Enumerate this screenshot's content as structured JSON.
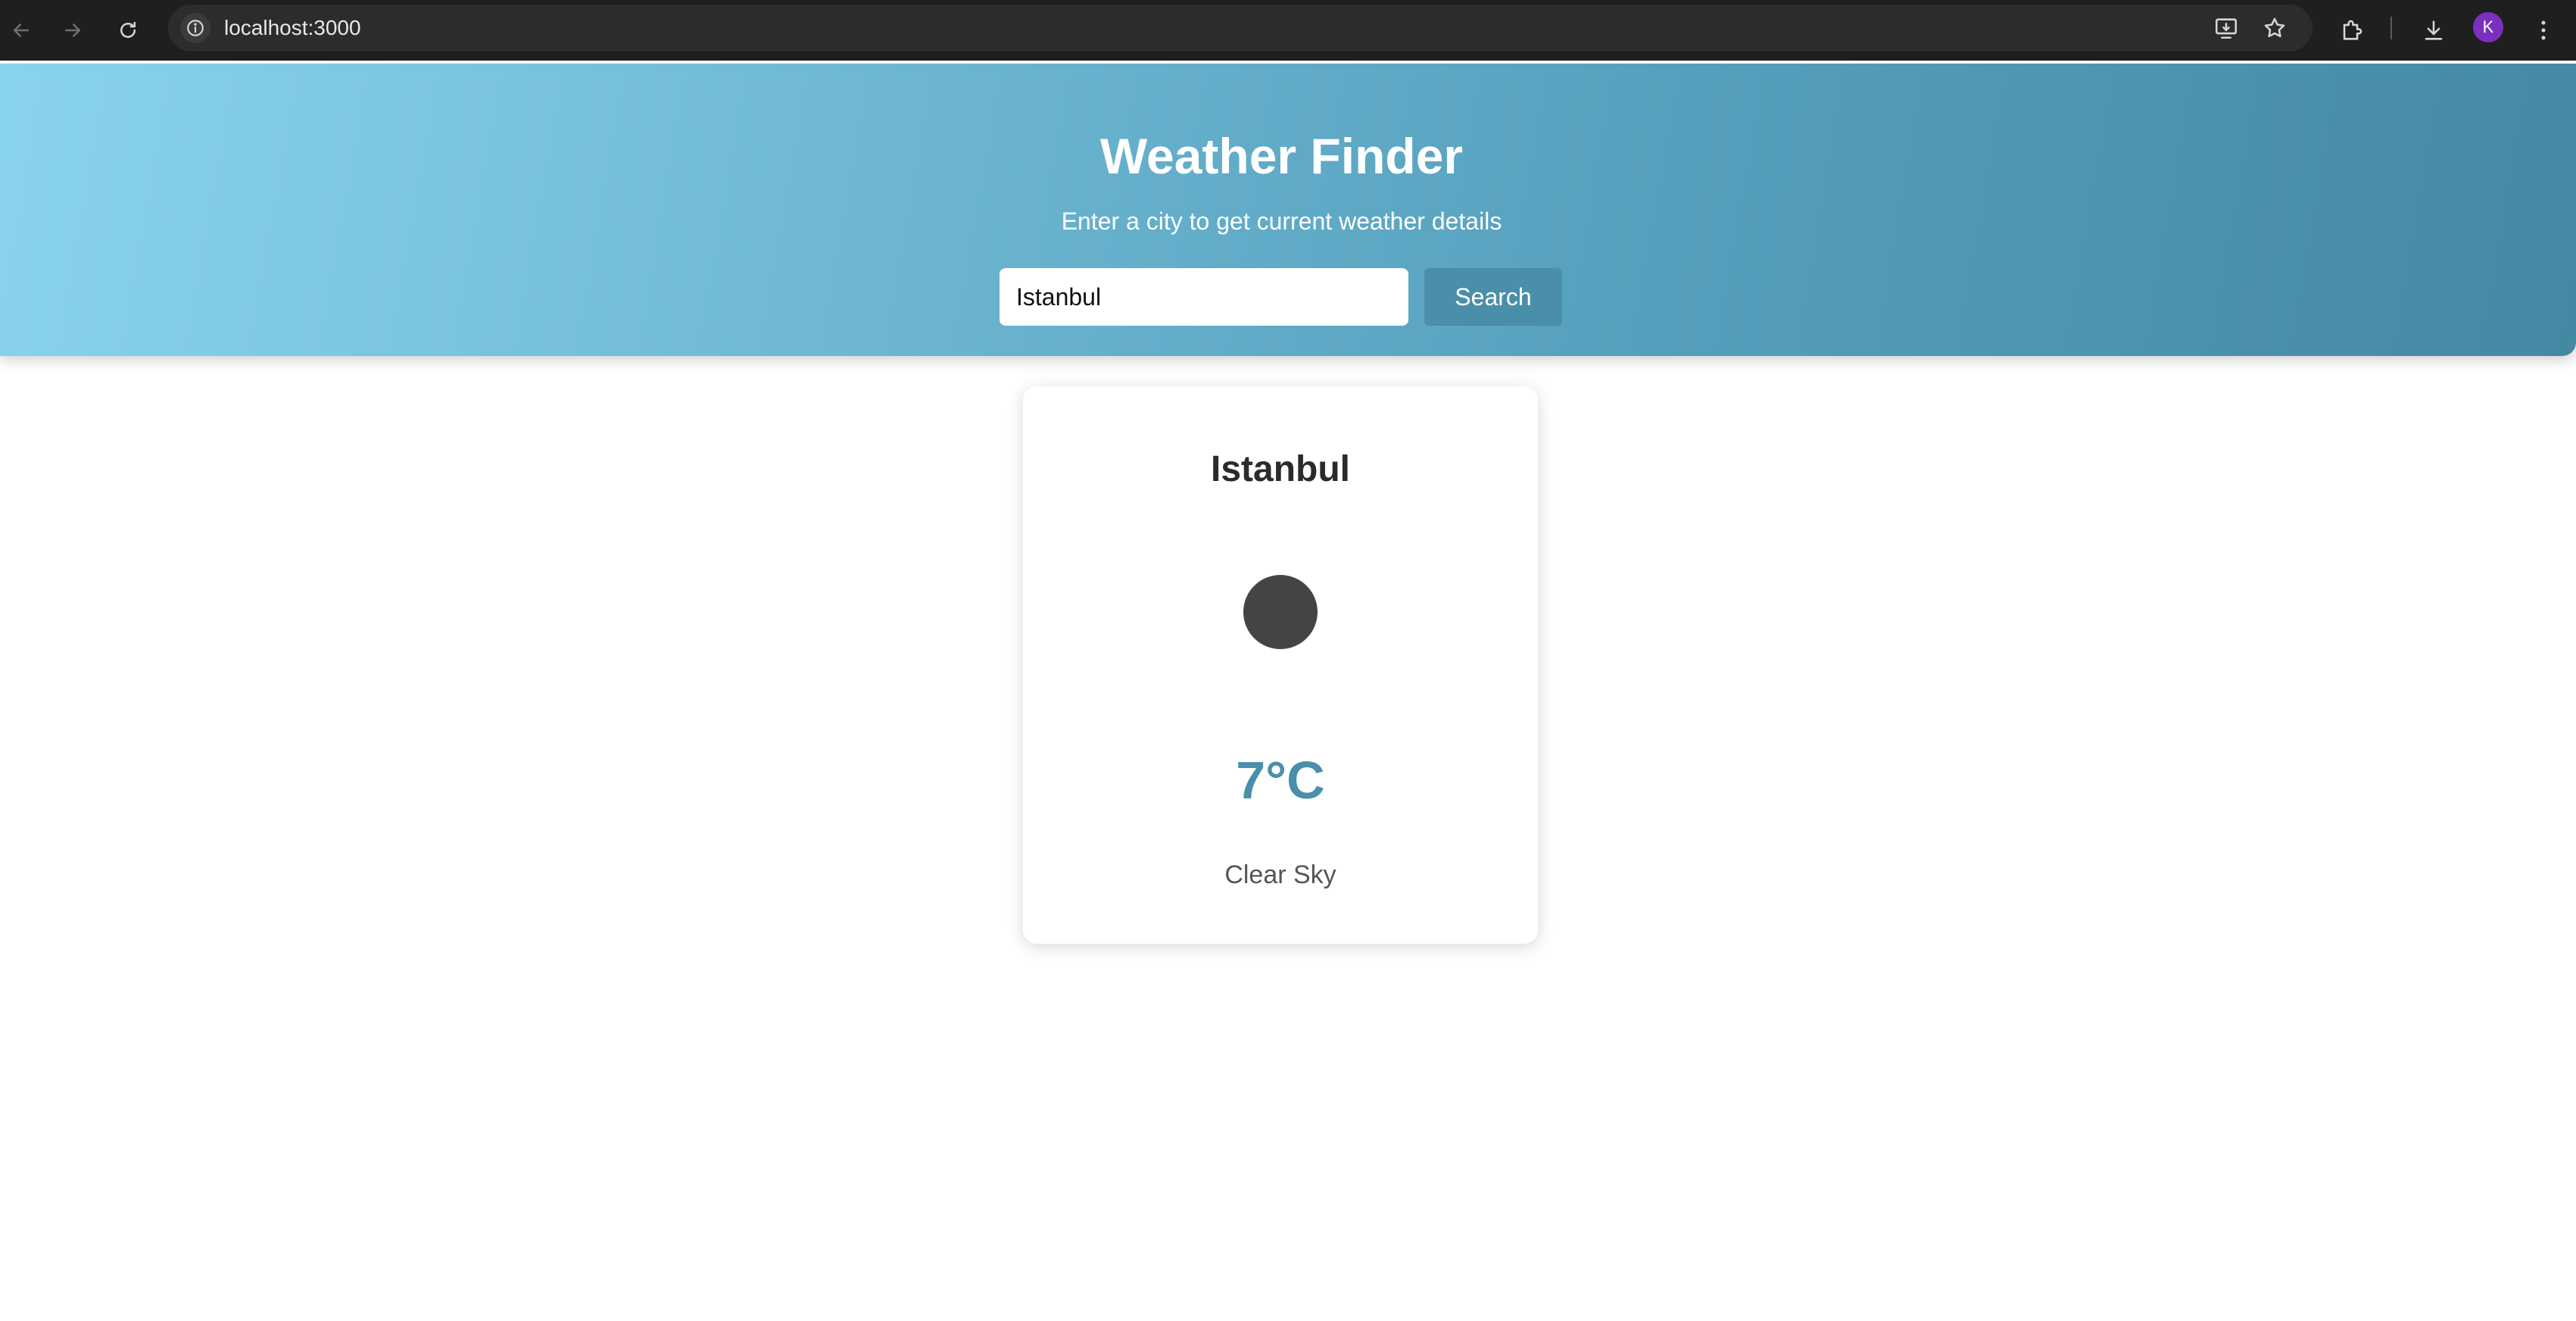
{
  "browser": {
    "url": "localhost:3000",
    "profile_initial": "K",
    "icons": {
      "back": "arrow-left-icon",
      "forward": "arrow-right-icon",
      "reload": "reload-icon",
      "site_info": "info-icon",
      "install": "install-app-icon",
      "bookmark": "star-icon",
      "extensions": "puzzle-icon",
      "downloads": "download-icon",
      "menu": "kebab-menu-icon"
    }
  },
  "header": {
    "title": "Weather Finder",
    "subtitle": "Enter a city to get current weather details",
    "search": {
      "value": "Istanbul",
      "button_label": "Search"
    }
  },
  "weather": {
    "city": "Istanbul",
    "temperature": "7°C",
    "condition": "Clear Sky",
    "icon": "weather-circle-icon"
  },
  "colors": {
    "gradient_start": "#89d4ec",
    "gradient_end": "#4488a4",
    "accent": "#4a8fa9",
    "avatar": "#7b2fbe"
  }
}
